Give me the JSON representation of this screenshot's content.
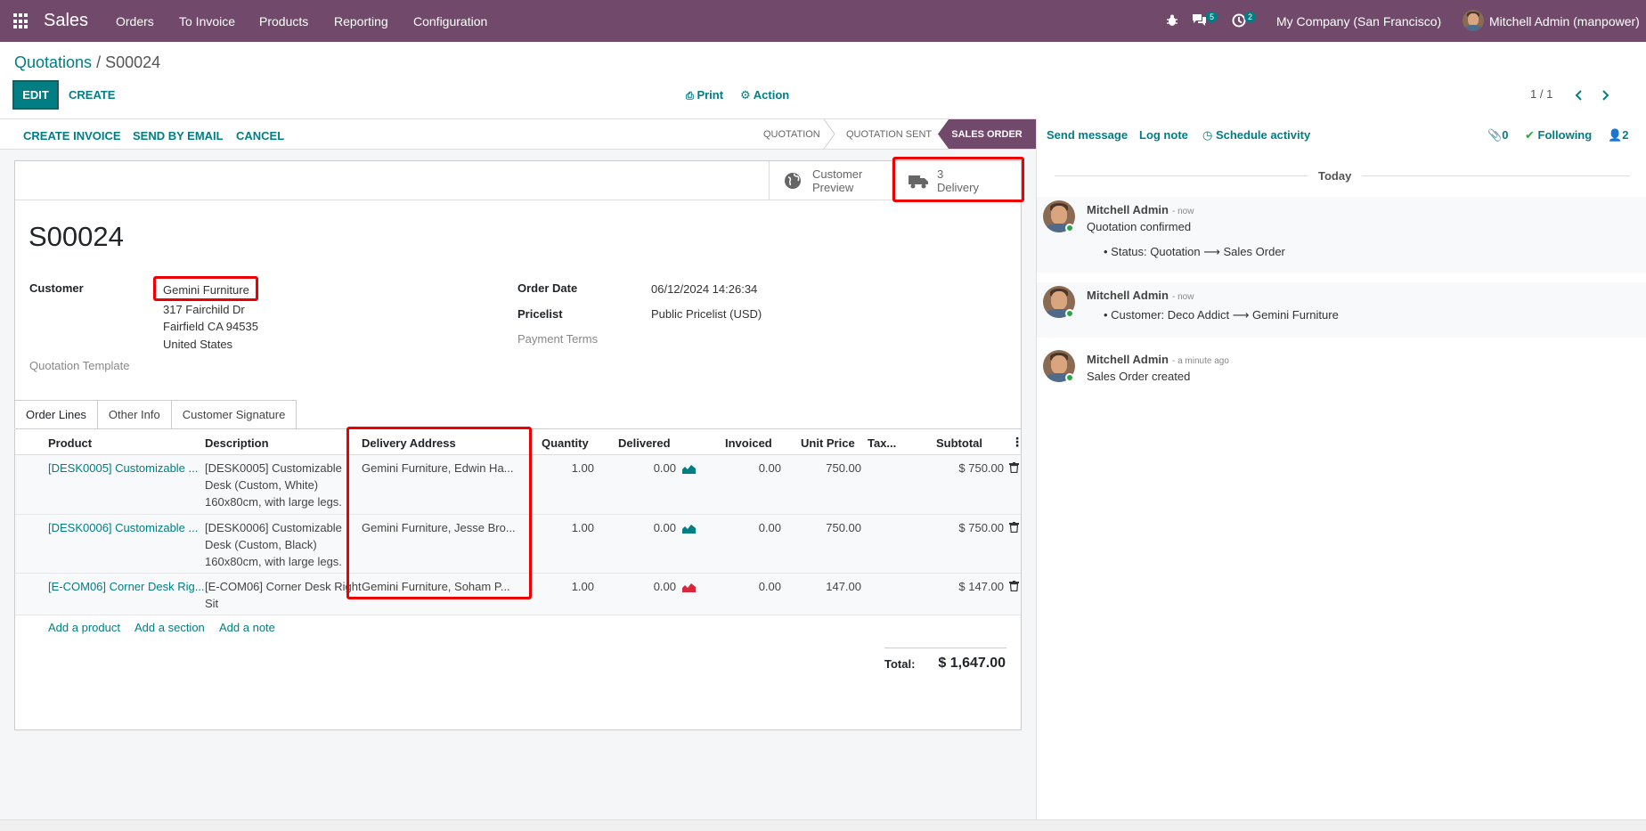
{
  "app": {
    "name": "Sales",
    "menu": [
      "Orders",
      "To Invoice",
      "Products",
      "Reporting",
      "Configuration"
    ],
    "messages_count": "5",
    "activities_count": "2",
    "company": "My Company (San Francisco)",
    "user": "Mitchell Admin (manpower)"
  },
  "breadcrumb": {
    "parent": "Quotations",
    "separator": "/",
    "current": "S00024"
  },
  "control": {
    "edit": "EDIT",
    "create": "CREATE",
    "print": "Print",
    "action": "Action",
    "pager": "1 / 1"
  },
  "statusbar": {
    "create_invoice": "CREATE INVOICE",
    "send_email": "SEND BY EMAIL",
    "cancel": "CANCEL",
    "stages": [
      "QUOTATION",
      "QUOTATION SENT"
    ],
    "active_stage": "SALES ORDER"
  },
  "smart_buttons": {
    "preview_line1": "Customer",
    "preview_line2": "Preview",
    "delivery_count": "3",
    "delivery_label": "Delivery"
  },
  "order": {
    "name": "S00024",
    "customer_label": "Customer",
    "customer": "Gemini Furniture",
    "address": [
      "317 Fairchild Dr",
      "Fairfield CA 94535",
      "United States"
    ],
    "template_label": "Quotation Template",
    "order_date_label": "Order Date",
    "order_date": "06/12/2024 14:26:34",
    "pricelist_label": "Pricelist",
    "pricelist": "Public Pricelist (USD)",
    "payment_terms_label": "Payment Terms"
  },
  "tabs": [
    "Order Lines",
    "Other Info",
    "Customer Signature"
  ],
  "table": {
    "headers": {
      "product": "Product",
      "description": "Description",
      "delivery_address": "Delivery Address",
      "quantity": "Quantity",
      "delivered": "Delivered",
      "invoiced": "Invoiced",
      "unit_price": "Unit Price",
      "taxes": "Tax...",
      "subtotal": "Subtotal"
    },
    "rows": [
      {
        "product": "[DESK0005] Customizable ...",
        "description": [
          "[DESK0005] Customizable",
          "Desk (Custom, White)",
          "160x80cm, with large legs."
        ],
        "delivery_address": "Gemini Furniture, Edwin Ha...",
        "quantity": "1.00",
        "delivered": "0.00",
        "invoiced": "0.00",
        "unit_price": "750.00",
        "subtotal": "$ 750.00"
      },
      {
        "product": "[DESK0006] Customizable ...",
        "description": [
          "[DESK0006] Customizable",
          "Desk (Custom, Black)",
          "160x80cm, with large legs."
        ],
        "delivery_address": "Gemini Furniture, Jesse Bro...",
        "quantity": "1.00",
        "delivered": "0.00",
        "invoiced": "0.00",
        "unit_price": "750.00",
        "subtotal": "$ 750.00"
      },
      {
        "product": "[E-COM06] Corner Desk Rig...",
        "description": [
          "[E-COM06] Corner Desk Right",
          "Sit"
        ],
        "delivery_address": "Gemini Furniture, Soham P...",
        "quantity": "1.00",
        "delivered": "0.00",
        "invoiced": "0.00",
        "unit_price": "147.00",
        "subtotal": "$ 147.00"
      }
    ],
    "add_product": "Add a product",
    "add_section": "Add a section",
    "add_note": "Add a note",
    "total_label": "Total:",
    "total": "$ 1,647.00"
  },
  "chatter": {
    "send_message": "Send message",
    "log_note": "Log note",
    "schedule_activity": "Schedule activity",
    "attachments": "0",
    "following": "Following",
    "followers": "2",
    "date_separator": "Today",
    "messages": [
      {
        "author": "Mitchell Admin",
        "time": "- now",
        "body": "Quotation confirmed",
        "change_field": "Status:",
        "change_from": "Quotation",
        "change_to": "Sales Order"
      },
      {
        "author": "Mitchell Admin",
        "time": "- now",
        "change_field": "Customer:",
        "change_from": "Deco Addict",
        "change_to": "Gemini Furniture"
      },
      {
        "author": "Mitchell Admin",
        "time": "- a minute ago",
        "body": "Sales Order created"
      }
    ]
  },
  "colors": {
    "brand": "#71496a",
    "accent": "#017e84",
    "highlight": "#e00000"
  }
}
